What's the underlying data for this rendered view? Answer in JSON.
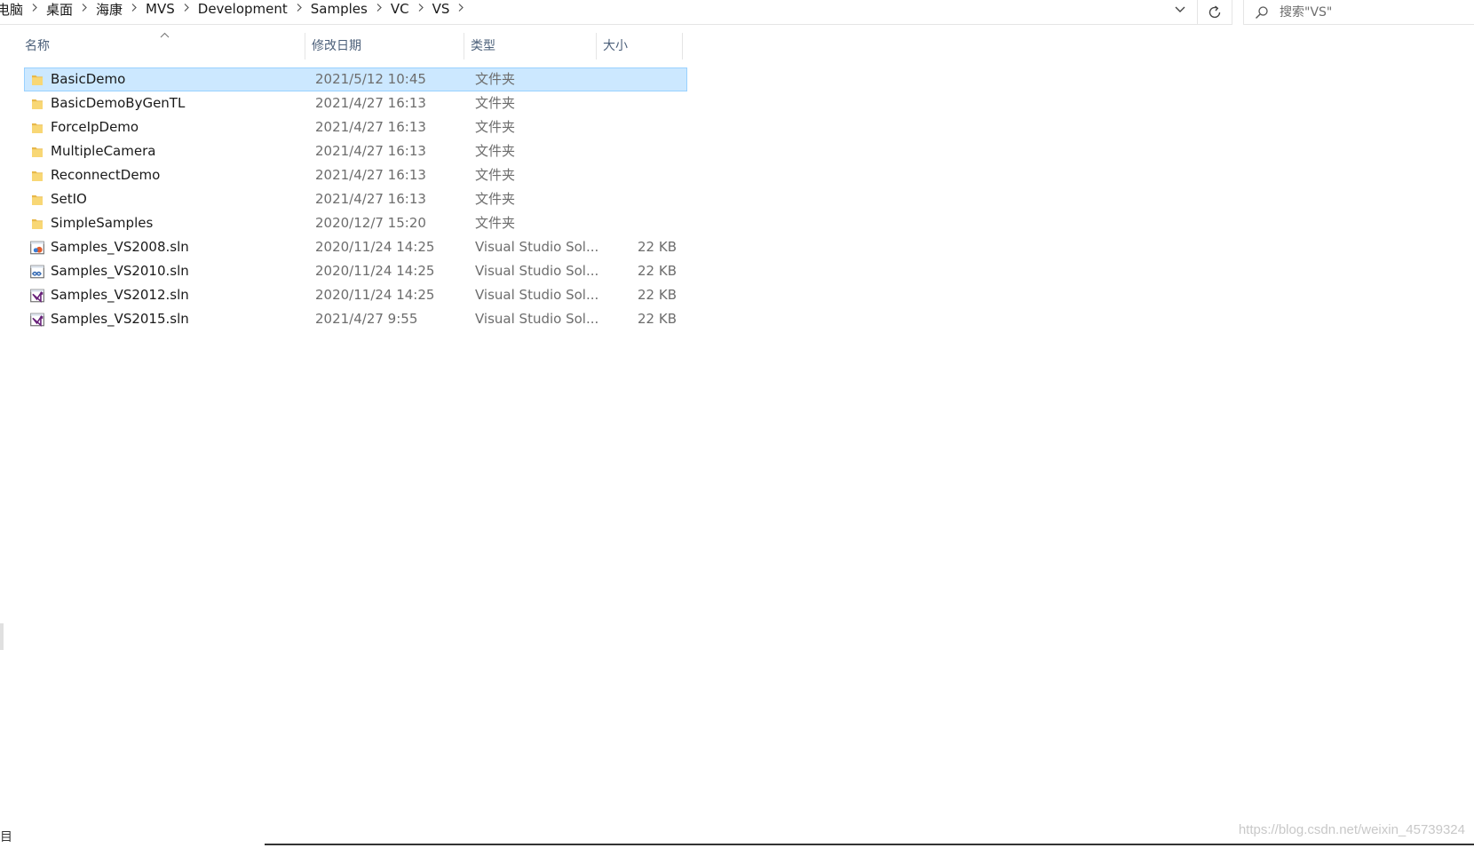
{
  "breadcrumb": {
    "items": [
      "电脑",
      "桌面",
      "海康",
      "MVS",
      "Development",
      "Samples",
      "VC",
      "VS"
    ],
    "separator": ">"
  },
  "addressbar": {
    "dropdown_icon": "chevron-down-icon",
    "refresh_icon": "refresh-icon"
  },
  "search": {
    "placeholder": "搜索\"VS\"",
    "icon": "search-icon"
  },
  "columns": {
    "name": "名称",
    "date": "修改日期",
    "type": "类型",
    "size": "大小",
    "sort_indicator": "^"
  },
  "files": [
    {
      "name": "BasicDemo",
      "date": "2021/5/12 10:45",
      "type": "文件夹",
      "size": "",
      "icon": "folder-icon",
      "selected": true
    },
    {
      "name": "BasicDemoByGenTL",
      "date": "2021/4/27 16:13",
      "type": "文件夹",
      "size": "",
      "icon": "folder-icon",
      "selected": false
    },
    {
      "name": "ForceIpDemo",
      "date": "2021/4/27 16:13",
      "type": "文件夹",
      "size": "",
      "icon": "folder-icon",
      "selected": false
    },
    {
      "name": "MultipleCamera",
      "date": "2021/4/27 16:13",
      "type": "文件夹",
      "size": "",
      "icon": "folder-icon",
      "selected": false
    },
    {
      "name": "ReconnectDemo",
      "date": "2021/4/27 16:13",
      "type": "文件夹",
      "size": "",
      "icon": "folder-icon",
      "selected": false
    },
    {
      "name": "SetIO",
      "date": "2021/4/27 16:13",
      "type": "文件夹",
      "size": "",
      "icon": "folder-icon",
      "selected": false
    },
    {
      "name": "SimpleSamples",
      "date": "2020/12/7 15:20",
      "type": "文件夹",
      "size": "",
      "icon": "folder-icon",
      "selected": false
    },
    {
      "name": "Samples_VS2008.sln",
      "date": "2020/11/24 14:25",
      "type": "Visual Studio Sol...",
      "size": "22 KB",
      "icon": "vs2008-solution-icon",
      "selected": false
    },
    {
      "name": "Samples_VS2010.sln",
      "date": "2020/11/24 14:25",
      "type": "Visual Studio Sol...",
      "size": "22 KB",
      "icon": "vs2010-solution-icon",
      "selected": false
    },
    {
      "name": "Samples_VS2012.sln",
      "date": "2020/11/24 14:25",
      "type": "Visual Studio Sol...",
      "size": "22 KB",
      "icon": "vs2012-solution-icon",
      "selected": false
    },
    {
      "name": "Samples_VS2015.sln",
      "date": "2021/4/27 9:55",
      "type": "Visual Studio Sol...",
      "size": "22 KB",
      "icon": "vs2015-solution-icon",
      "selected": false
    }
  ],
  "status": {
    "view_icon": "details-view-icon",
    "view_glyph": "目"
  },
  "watermark": "https://blog.csdn.net/weixin_45739324",
  "colors": {
    "selection_bg": "#cce8ff",
    "selection_border": "#99d1ff",
    "header_text": "#4c607a",
    "secondary_text": "#6d6d6d",
    "folder_yellow": "#f8d775"
  }
}
